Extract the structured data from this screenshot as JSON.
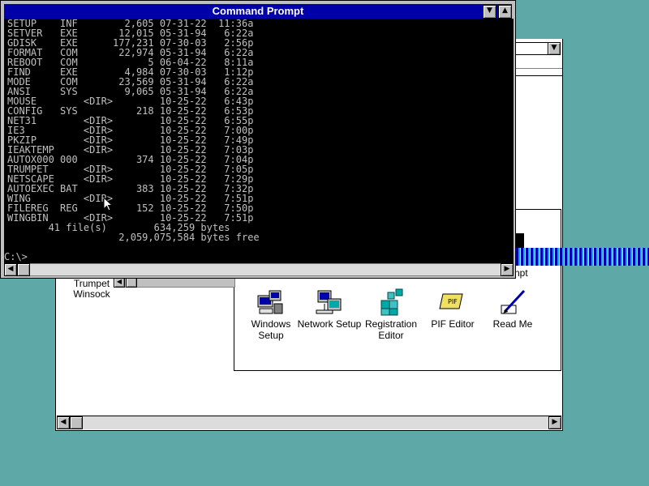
{
  "command_prompt": {
    "title": "Command Prompt",
    "listing": [
      "SETUP    INF        2,605 07-31-22  11:36a",
      "SETVER   EXE       12,015 05-31-94   6:22a",
      "GDISK    EXE      177,231 07-30-03   2:56p",
      "FORMAT   COM       22,974 05-31-94   6:22a",
      "REBOOT   COM            5 06-04-22   8:11a",
      "FIND     EXE        4,984 07-30-03   1:12p",
      "MODE     COM       23,569 05-31-94   6:22a",
      "ANSI     SYS        9,065 05-31-94   6:22a",
      "MOUSE        <DIR>        10-25-22   6:43p",
      "CONFIG   SYS          218 10-25-22   6:53p",
      "NET31        <DIR>        10-25-22   6:55p",
      "IE3          <DIR>        10-25-22   7:00p",
      "PKZIP        <DIR>        10-25-22   7:49p",
      "IEAKTEMP     <DIR>        10-25-22   7:03p",
      "AUTOX000 000          374 10-25-22   7:04p",
      "TRUMPET      <DIR>        10-25-22   7:05p",
      "NETSCAPE     <DIR>        10-25-22   7:29p",
      "AUTOEXEC BAT          383 10-25-22   7:32p",
      "WING         <DIR>        10-25-22   7:51p",
      "FILEREG  REG          152 10-25-22   7:50p",
      "WINGBIN      <DIR>        10-25-22   7:51p",
      "       41 file(s)        634,259 bytes",
      "                   2,059,075,584 bytes free"
    ],
    "prompt": "C:\\>"
  },
  "trumpet": {
    "label": "Trumpet Winsock"
  },
  "group_icons": [
    {
      "icon": "windows-setup-icon",
      "label": "Windows Setup"
    },
    {
      "icon": "network-setup-icon",
      "label": "Network Setup"
    },
    {
      "icon": "registration-editor-icon",
      "label": "Registration Editor"
    },
    {
      "icon": "pif-editor-icon",
      "label": "PIF Editor"
    },
    {
      "icon": "read-me-icon",
      "label": "Read Me"
    }
  ],
  "partial_text": "npt",
  "colors": {
    "desktop": "#5fa8a8",
    "titlebar": "#0000a8",
    "console_bg": "#000000",
    "console_fg": "#c0c0c0"
  }
}
